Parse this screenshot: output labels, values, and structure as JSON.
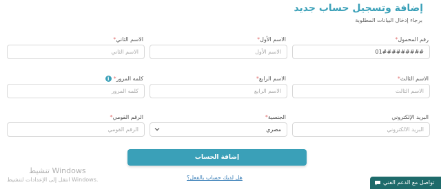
{
  "header": {
    "title": "إضافة وتسجيل حساب جديد",
    "subtitle": "برجاء إدخال البيانات المطلوبة"
  },
  "fields": {
    "mobile": {
      "label": "رقم المحمول",
      "required": true,
      "value": "01#########"
    },
    "first_name": {
      "label": "الاسم الأول",
      "required": true,
      "placeholder": "الاسم الأول"
    },
    "second_name": {
      "label": "الاسم الثاني",
      "required": true,
      "placeholder": "الاسم الثاني"
    },
    "third_name": {
      "label": "الاسم الثالث",
      "required": true,
      "placeholder": "الاسم الثالث"
    },
    "fourth_name": {
      "label": "الاسم الرابع",
      "required": true,
      "placeholder": "الاسم الرابع"
    },
    "password": {
      "label": "كلمه المرور",
      "required": true,
      "placeholder": "كلمه المرور",
      "info_icon": "info-icon"
    },
    "email": {
      "label": "البريد الإلكتروني",
      "required": false,
      "placeholder": "البريد الالكتروني"
    },
    "nationality": {
      "label": "الجنسية",
      "required": true,
      "value": "مصري"
    },
    "national_id": {
      "label": "الرقم القومي",
      "required": true,
      "placeholder": "الرقم القومي"
    }
  },
  "actions": {
    "submit_label": "إضافة الحساب",
    "login_link": "هل لديك حساب بالفعل؟"
  },
  "watermark": {
    "title": "تنشيط Windows",
    "subtitle": "انتقل إلى الإعدادات لتنشيط Windows."
  },
  "support": {
    "label": "تواصل مع الدعم الفني"
  },
  "colors": {
    "accent": "#3aa0b8",
    "support_bg": "#1e6b6b",
    "required_mark": "#e07070"
  }
}
